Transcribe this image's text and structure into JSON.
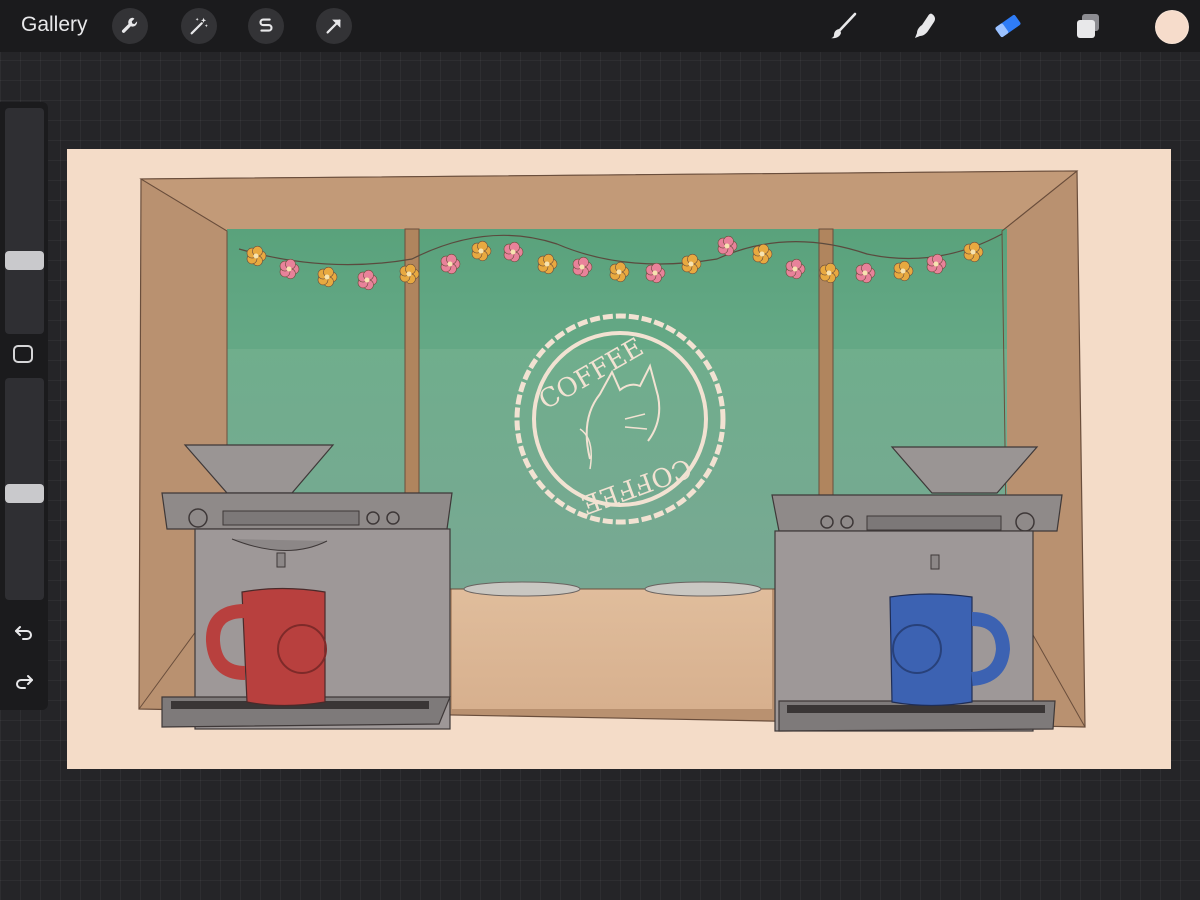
{
  "toolbar": {
    "gallery_label": "Gallery",
    "left_tools": [
      {
        "name": "actions",
        "icon": "wrench-icon"
      },
      {
        "name": "adjustments",
        "icon": "magic-wand-icon"
      },
      {
        "name": "selection",
        "icon": "selection-s-icon"
      },
      {
        "name": "transform",
        "icon": "arrow-cursor-icon"
      }
    ],
    "right_tools": [
      {
        "name": "brush",
        "icon": "brush-icon"
      },
      {
        "name": "smudge",
        "icon": "smudge-finger-icon"
      },
      {
        "name": "eraser",
        "icon": "eraser-icon",
        "active": true
      },
      {
        "name": "layers",
        "icon": "layers-icon"
      }
    ],
    "current_color": "#f6dccb",
    "active_tool_color": "#2f7cf6"
  },
  "sidebar": {
    "brush_size_level": 0.31,
    "opacity_level": 0.48,
    "icons": [
      "square-modify-icon",
      "undo-icon",
      "redo-icon"
    ]
  },
  "canvas": {
    "artwork": {
      "colors": {
        "paper": "#f4dcc8",
        "frame": "#b89070",
        "window": "#6fa88e",
        "wall": "#deb896",
        "machine": "#8e8a89",
        "red_mug": "#b8403e",
        "blue_mug": "#3c62b2",
        "flower_pink": "#e8829a",
        "flower_yellow": "#e8a940"
      },
      "sign_text_top": "COFFEE",
      "sign_text_bottom": "COFFEE"
    }
  }
}
